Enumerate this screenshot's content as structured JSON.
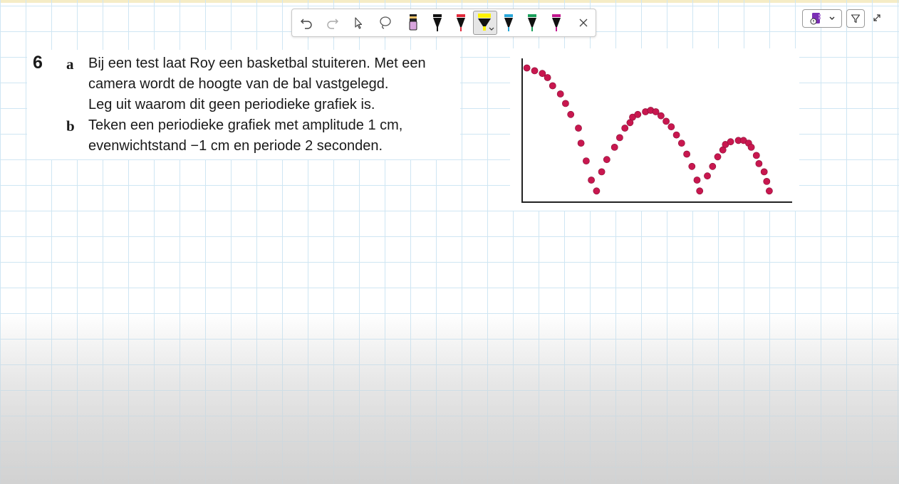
{
  "toolbar": {
    "tools": [
      {
        "name": "undo-button",
        "icon": "undo-icon"
      },
      {
        "name": "redo-button",
        "icon": "redo-icon"
      },
      {
        "name": "select-button",
        "icon": "cursor-arrow-icon"
      },
      {
        "name": "lasso-button",
        "icon": "lasso-icon"
      },
      {
        "name": "eraser-button",
        "icon": "eraser-icon",
        "color": "#d9a5de"
      },
      {
        "name": "pen-black-button",
        "icon": "pen-icon",
        "color": "#111111"
      },
      {
        "name": "pen-red-button",
        "icon": "pen-icon",
        "color": "#e0283a"
      },
      {
        "name": "highlighter-yellow-button",
        "icon": "highlighter-icon",
        "color": "#fff200",
        "selected": true
      },
      {
        "name": "pen-blue-button",
        "icon": "pen-icon",
        "color": "#2aa7d9"
      },
      {
        "name": "pen-green-button",
        "icon": "pen-icon",
        "color": "#1a9f5a"
      },
      {
        "name": "pen-magenta-button",
        "icon": "pen-icon",
        "color": "#c2188e"
      },
      {
        "name": "close-button",
        "icon": "close-icon"
      }
    ]
  },
  "controls": {
    "onenote_icon_color": "#7b2fb5",
    "filter_icon": "filter-icon",
    "expand_icon": "expand-icon"
  },
  "exercise": {
    "number": "6",
    "parts": [
      {
        "letter": "a",
        "lines": [
          "Bij een test laat Roy een basketbal stuiteren. Met een",
          "camera wordt de hoogte van de bal vastgelegd.",
          "Leg uit waarom dit geen periodieke grafiek is."
        ]
      },
      {
        "letter": "b",
        "lines": [
          "Teken een periodieke grafiek met amplitude 1 cm,",
          "evenwichtstand −1 cm en periode 2 seconden."
        ]
      }
    ]
  },
  "chart_data": {
    "type": "scatter",
    "title": "",
    "xlabel": "",
    "ylabel": "",
    "grid": false,
    "xlim": [
      0,
      100
    ],
    "ylim": [
      0,
      100
    ],
    "marker_color": "#c8174f",
    "points": [
      [
        1,
        94
      ],
      [
        4,
        92
      ],
      [
        7,
        90
      ],
      [
        9,
        87
      ],
      [
        11,
        81
      ],
      [
        14,
        75
      ],
      [
        16,
        68
      ],
      [
        18,
        60
      ],
      [
        21,
        50
      ],
      [
        22,
        39
      ],
      [
        24,
        26
      ],
      [
        26,
        12
      ],
      [
        28,
        4
      ],
      [
        30,
        18
      ],
      [
        32,
        27
      ],
      [
        35,
        36
      ],
      [
        37,
        43
      ],
      [
        39,
        50
      ],
      [
        41,
        54
      ],
      [
        42,
        58
      ],
      [
        44,
        60
      ],
      [
        47,
        62
      ],
      [
        49,
        63
      ],
      [
        51,
        62
      ],
      [
        53,
        59
      ],
      [
        55,
        55
      ],
      [
        57,
        51
      ],
      [
        59,
        45
      ],
      [
        61,
        39
      ],
      [
        63,
        31
      ],
      [
        65,
        22
      ],
      [
        67,
        12
      ],
      [
        68,
        4
      ],
      [
        71,
        15
      ],
      [
        73,
        22
      ],
      [
        75,
        29
      ],
      [
        77,
        34
      ],
      [
        78,
        38
      ],
      [
        80,
        40
      ],
      [
        83,
        41
      ],
      [
        85,
        41
      ],
      [
        87,
        39
      ],
      [
        88,
        36
      ],
      [
        90,
        30
      ],
      [
        91,
        24
      ],
      [
        93,
        18
      ],
      [
        94,
        11
      ],
      [
        95,
        4
      ]
    ]
  }
}
